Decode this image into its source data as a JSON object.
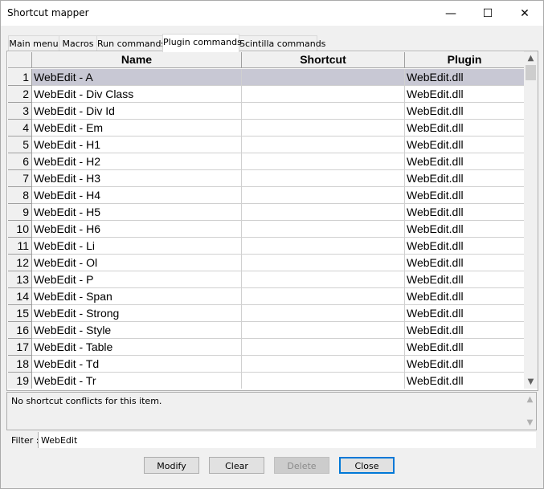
{
  "window": {
    "title": "Shortcut mapper",
    "minimize": "—",
    "maximize": "☐",
    "close": "✕"
  },
  "tabs": [
    {
      "label": "Main menu"
    },
    {
      "label": "Macros"
    },
    {
      "label": "Run commands"
    },
    {
      "label": "Plugin commands"
    },
    {
      "label": "Scintilla commands"
    }
  ],
  "active_tab": "Plugin commands",
  "grid": {
    "headers": {
      "name": "Name",
      "shortcut": "Shortcut",
      "plugin": "Plugin"
    },
    "selected_row": 1,
    "rows": [
      {
        "num": "1",
        "name": "WebEdit - A",
        "shortcut": "",
        "plugin": "WebEdit.dll"
      },
      {
        "num": "2",
        "name": "WebEdit - Div Class",
        "shortcut": "",
        "plugin": "WebEdit.dll"
      },
      {
        "num": "3",
        "name": "WebEdit - Div Id",
        "shortcut": "",
        "plugin": "WebEdit.dll"
      },
      {
        "num": "4",
        "name": "WebEdit - Em",
        "shortcut": "",
        "plugin": "WebEdit.dll"
      },
      {
        "num": "5",
        "name": "WebEdit - H1",
        "shortcut": "",
        "plugin": "WebEdit.dll"
      },
      {
        "num": "6",
        "name": "WebEdit - H2",
        "shortcut": "",
        "plugin": "WebEdit.dll"
      },
      {
        "num": "7",
        "name": "WebEdit - H3",
        "shortcut": "",
        "plugin": "WebEdit.dll"
      },
      {
        "num": "8",
        "name": "WebEdit - H4",
        "shortcut": "",
        "plugin": "WebEdit.dll"
      },
      {
        "num": "9",
        "name": "WebEdit - H5",
        "shortcut": "",
        "plugin": "WebEdit.dll"
      },
      {
        "num": "10",
        "name": "WebEdit - H6",
        "shortcut": "",
        "plugin": "WebEdit.dll"
      },
      {
        "num": "11",
        "name": "WebEdit - Li",
        "shortcut": "",
        "plugin": "WebEdit.dll"
      },
      {
        "num": "12",
        "name": "WebEdit - Ol",
        "shortcut": "",
        "plugin": "WebEdit.dll"
      },
      {
        "num": "13",
        "name": "WebEdit - P",
        "shortcut": "",
        "plugin": "WebEdit.dll"
      },
      {
        "num": "14",
        "name": "WebEdit - Span",
        "shortcut": "",
        "plugin": "WebEdit.dll"
      },
      {
        "num": "15",
        "name": "WebEdit - Strong",
        "shortcut": "",
        "plugin": "WebEdit.dll"
      },
      {
        "num": "16",
        "name": "WebEdit - Style",
        "shortcut": "",
        "plugin": "WebEdit.dll"
      },
      {
        "num": "17",
        "name": "WebEdit - Table",
        "shortcut": "",
        "plugin": "WebEdit.dll"
      },
      {
        "num": "18",
        "name": "WebEdit - Td",
        "shortcut": "",
        "plugin": "WebEdit.dll"
      },
      {
        "num": "19",
        "name": "WebEdit - Tr",
        "shortcut": "",
        "plugin": "WebEdit.dll"
      }
    ]
  },
  "message": "No shortcut conflicts for this item.",
  "filter": {
    "label": "Filter :",
    "value": "WebEdit"
  },
  "buttons": {
    "modify": "Modify",
    "clear": "Clear",
    "delete": "Delete",
    "close": "Close"
  },
  "icons": {
    "scroll_up": "chevron-up-icon",
    "scroll_down": "chevron-down-icon"
  },
  "colors": {
    "selected_row": "#c8c8d4",
    "default_button_border": "#0078d7"
  }
}
